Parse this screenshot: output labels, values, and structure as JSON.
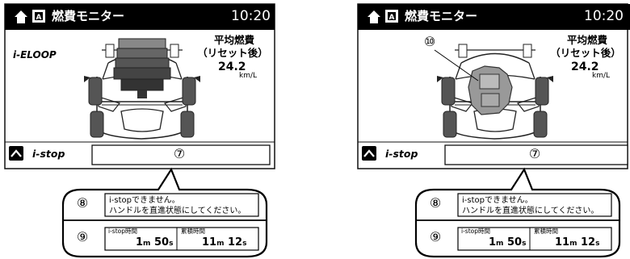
{
  "screens": [
    {
      "title": "燃費モニター",
      "clock": "10:20",
      "eloop_label": "i-ELOOP",
      "avg_title": "平均燃費",
      "avg_note": "（リセット後）",
      "avg_value": "24.2",
      "avg_unit": "km/L",
      "istop_label": "i-stop",
      "callout_num": "⑦",
      "message_num": "⑧",
      "message": "i-stopできません。\nハンドルを直進状態にしてください。",
      "timer_num": "⑨",
      "istop_time_label": "i-stop時間",
      "istop_time": {
        "m": "1",
        "m_unit": "m",
        "s": "50",
        "s_unit": "s"
      },
      "total_time_label": "累積時間",
      "total_time": {
        "m": "11",
        "m_unit": "m",
        "s": "12",
        "s_unit": "s"
      }
    },
    {
      "title": "燃費モニター",
      "clock": "10:20",
      "engine_num": "⑩",
      "avg_title": "平均燃費",
      "avg_note": "（リセット後）",
      "avg_value": "24.2",
      "avg_unit": "km/L",
      "istop_label": "i-stop",
      "callout_num": "⑦",
      "message_num": "⑧",
      "message": "i-stopできません。\nハンドルを直進状態にしてください。",
      "timer_num": "⑨",
      "istop_time_label": "i-stop時間",
      "istop_time": {
        "m": "1",
        "m_unit": "m",
        "s": "50",
        "s_unit": "s"
      },
      "total_time_label": "累積時間",
      "total_time": {
        "m": "11",
        "m_unit": "m",
        "s": "12",
        "s_unit": "s"
      }
    }
  ]
}
